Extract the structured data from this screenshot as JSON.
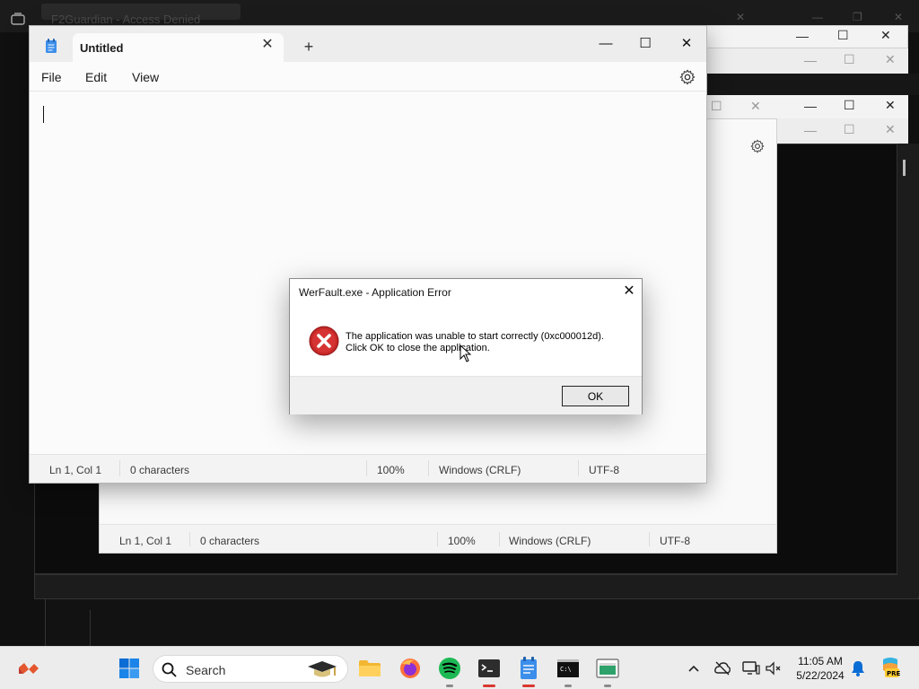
{
  "background": {
    "faded_title": "F2Guardian - Access Denied"
  },
  "notepad_back": {
    "status": {
      "position": "Ln 1, Col 1",
      "characters": "0 characters",
      "zoom": "100%",
      "line_ending": "Windows (CRLF)",
      "encoding": "UTF-8"
    }
  },
  "notepad": {
    "tab_title": "Untitled",
    "menu": {
      "file": "File",
      "edit": "Edit",
      "view": "View"
    },
    "status": {
      "position": "Ln 1, Col 1",
      "characters": "0 characters",
      "zoom": "100%",
      "line_ending": "Windows (CRLF)",
      "encoding": "UTF-8"
    }
  },
  "dialog": {
    "title": "WerFault.exe - Application Error",
    "message_line1": "The application was unable to start correctly (0xc000012d).",
    "message_line2": "Click OK to close the application.",
    "ok_label": "OK"
  },
  "taskbar": {
    "search_placeholder": "Search",
    "time": "11:05 AM",
    "date": "5/22/2024",
    "pinned": [
      "widgets-icon",
      "start-icon",
      "file-explorer-icon",
      "firefox-icon",
      "spotify-icon",
      "terminal-icon",
      "notepad-icon",
      "cmd-icon",
      "app-icon"
    ],
    "accent": "#0a6cd4"
  }
}
